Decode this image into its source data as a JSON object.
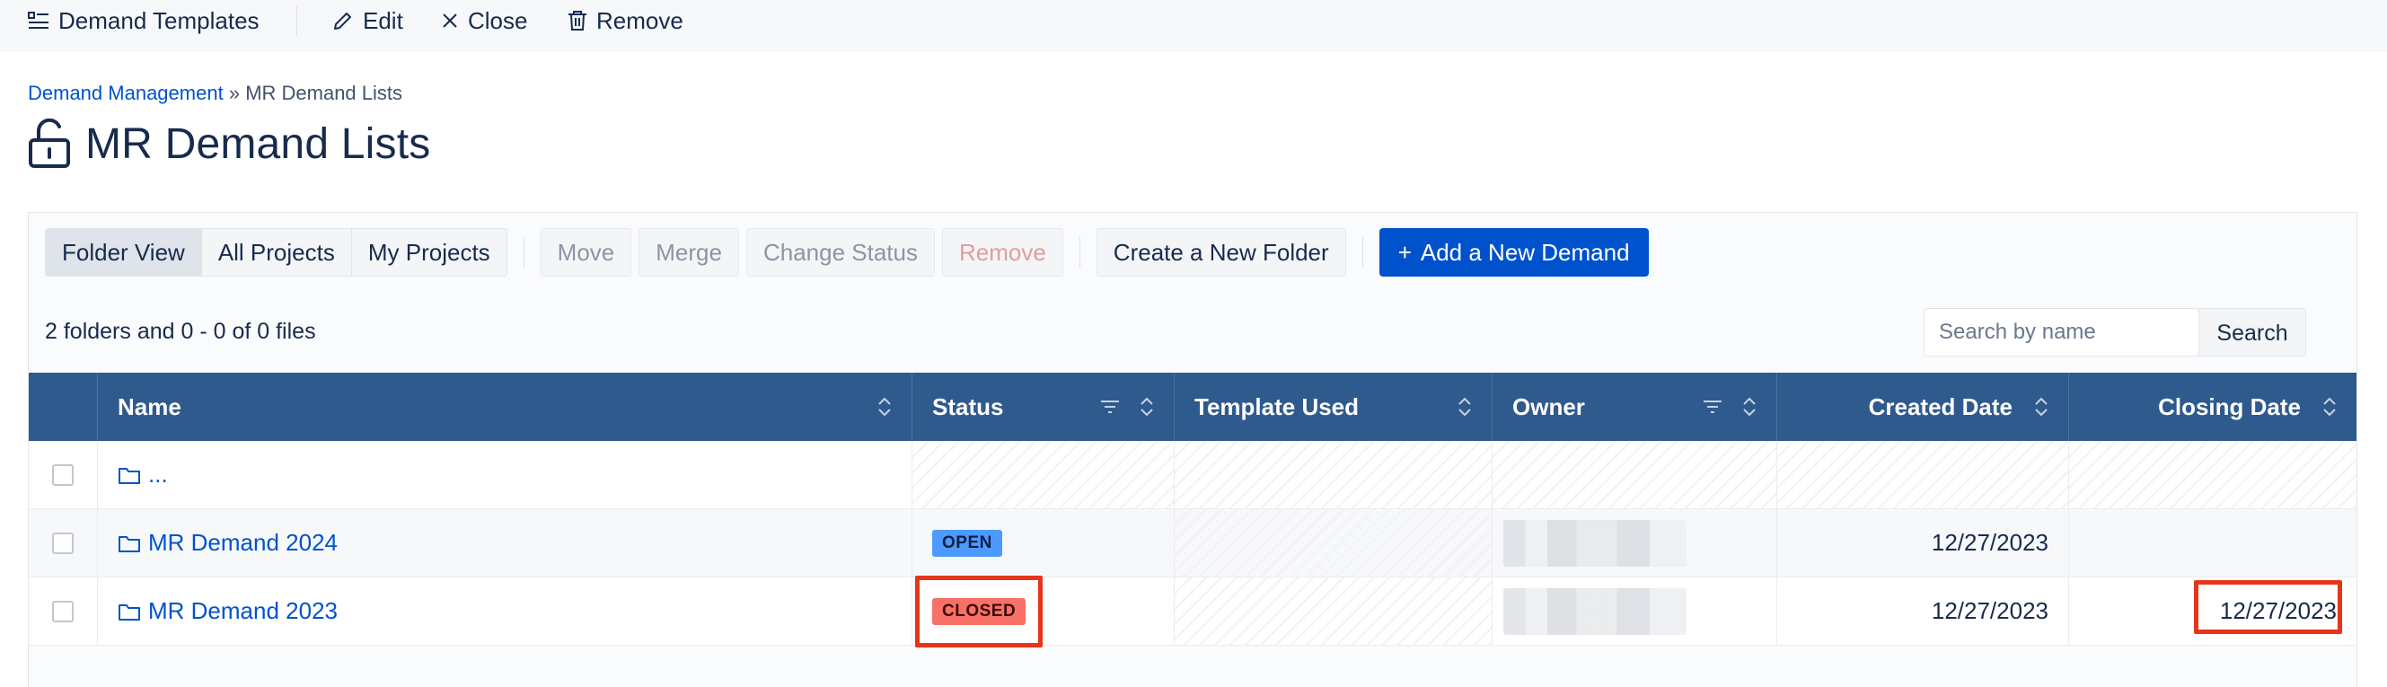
{
  "toolbar": {
    "templates_label": "Demand Templates",
    "edit_label": "Edit",
    "close_label": "Close",
    "remove_label": "Remove"
  },
  "breadcrumb": {
    "parent": "Demand Management",
    "separator": "»",
    "current": "MR Demand Lists"
  },
  "page": {
    "title": "MR Demand Lists"
  },
  "actions": {
    "views": [
      "Folder View",
      "All Projects",
      "My Projects"
    ],
    "active_view": "Folder View",
    "move": "Move",
    "merge": "Merge",
    "change_status": "Change Status",
    "remove": "Remove",
    "create_folder": "Create a New Folder",
    "add_demand": "Add a New Demand"
  },
  "summary": {
    "count_text": "2 folders and 0 - 0 of 0 files"
  },
  "search": {
    "placeholder": "Search by name",
    "value": "",
    "button": "Search"
  },
  "table": {
    "columns": [
      "Name",
      "Status",
      "Template Used",
      "Owner",
      "Created Date",
      "Closing Date"
    ],
    "rows": [
      {
        "name": "...",
        "status": "",
        "template": "",
        "owner": "",
        "created": "",
        "closing": ""
      },
      {
        "name": "MR Demand 2024",
        "status": "OPEN",
        "template": "",
        "owner": "(blurred)",
        "created": "12/27/2023",
        "closing": ""
      },
      {
        "name": "MR Demand 2023",
        "status": "CLOSED",
        "template": "",
        "owner": "(blurred)",
        "created": "12/27/2023",
        "closing": "12/27/2023"
      }
    ]
  },
  "colors": {
    "header_bg": "#2f5a8e",
    "primary": "#0052cc",
    "open_badge": "#4c9aff",
    "closed_badge": "#f87168",
    "highlight": "#e5351a"
  }
}
